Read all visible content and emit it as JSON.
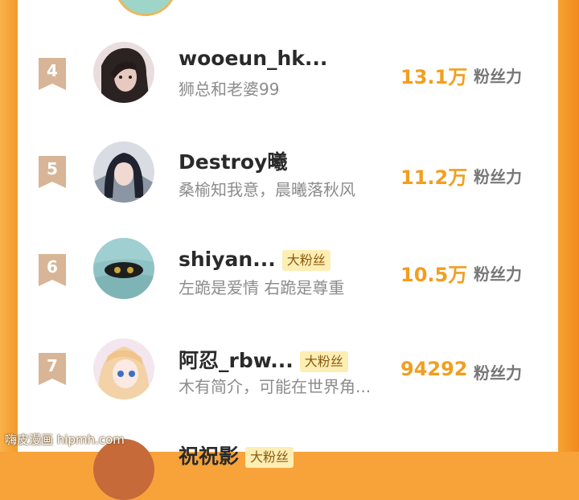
{
  "rows": [
    {
      "rank": "4",
      "name": "wooeun_hk...",
      "badge": "",
      "signature": "狮总和老婆99",
      "count": "13.1万",
      "unit": "粉丝力"
    },
    {
      "rank": "5",
      "name": "Destroy曦",
      "badge": "",
      "signature": "桑榆知我意，晨曦落秋风",
      "count": "11.2万",
      "unit": "粉丝力"
    },
    {
      "rank": "6",
      "name": "shiyan...",
      "badge": "大粉丝",
      "signature": "左跪是爱情 右跪是尊重",
      "count": "10.5万",
      "unit": "粉丝力"
    },
    {
      "rank": "7",
      "name": "阿忍_rbw...",
      "badge": "大粉丝",
      "signature": "木有简介，可能在世界角...",
      "count": "94292",
      "unit": "粉丝力"
    }
  ],
  "peek": {
    "name": "祝祝影",
    "badge": "大粉丝"
  },
  "watermark": "嗨皮漫画 hipmh.com"
}
